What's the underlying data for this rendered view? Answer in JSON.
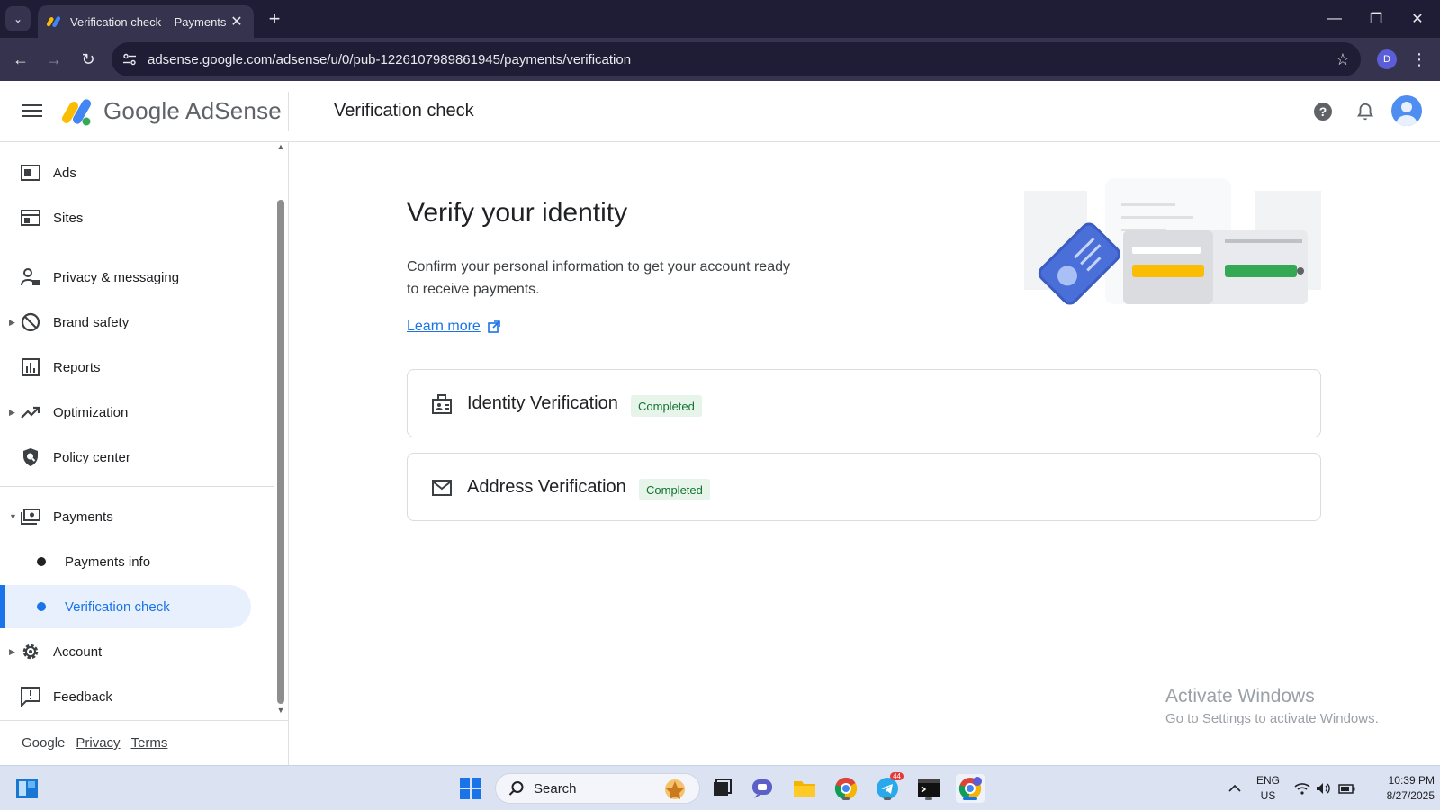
{
  "browser": {
    "tab_title": "Verification check – Payments –",
    "url": "adsense.google.com/adsense/u/0/pub-1226107989861945/payments/verification",
    "profile_initial": "D"
  },
  "app": {
    "brand": "Google AdSense",
    "page_title": "Verification check"
  },
  "sidebar": {
    "items": [
      {
        "label": "Ads"
      },
      {
        "label": "Sites"
      },
      {
        "label": "Privacy & messaging"
      },
      {
        "label": "Brand safety"
      },
      {
        "label": "Reports"
      },
      {
        "label": "Optimization"
      },
      {
        "label": "Policy center"
      },
      {
        "label": "Payments"
      },
      {
        "label": "Payments info"
      },
      {
        "label": "Verification check"
      },
      {
        "label": "Account"
      },
      {
        "label": "Feedback"
      }
    ],
    "footer": {
      "google": "Google",
      "privacy": "Privacy",
      "terms": "Terms"
    }
  },
  "main": {
    "heading": "Verify your identity",
    "description": "Confirm your personal information to get your account ready to receive payments.",
    "learn_more": "Learn more",
    "cards": [
      {
        "title": "Identity Verification",
        "status": "Completed"
      },
      {
        "title": "Address Verification",
        "status": "Completed"
      }
    ],
    "watermark_title": "Activate Windows",
    "watermark_sub": "Go to Settings to activate Windows."
  },
  "taskbar": {
    "search_placeholder": "Search",
    "lang_line1": "ENG",
    "lang_line2": "US",
    "time": "10:39 PM",
    "date": "8/27/2025",
    "telegram_badge": "44"
  },
  "colors": {
    "accent": "#1a73e8",
    "badge_bg": "#e6f4ea",
    "badge_text": "#137333",
    "chrome_dark": "#1f1d35"
  }
}
